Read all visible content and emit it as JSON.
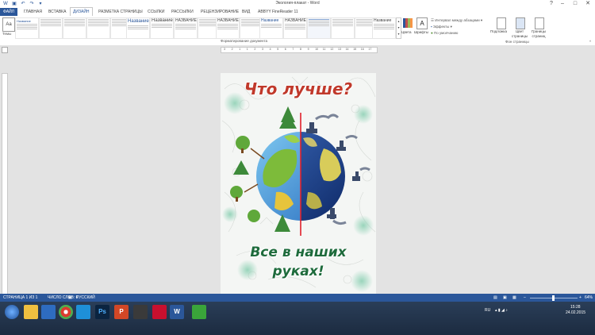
{
  "window": {
    "title": "Экология-плакат - Word"
  },
  "tabs": [
    {
      "label": "ФАЙЛ"
    },
    {
      "label": "ГЛАВНАЯ"
    },
    {
      "label": "ВСТАВКА"
    },
    {
      "label": "ДИЗАЙН"
    },
    {
      "label": "РАЗМЕТКА СТРАНИЦЫ"
    },
    {
      "label": "ССЫЛКИ"
    },
    {
      "label": "РАССЫЛКИ"
    },
    {
      "label": "РЕЦЕНЗИРОВАНИЕ"
    },
    {
      "label": "ВИД"
    },
    {
      "label": "ABBYY FineReader 11"
    }
  ],
  "ribbon": {
    "themes_label": "Темы",
    "doc_format_label": "Форматирование документа",
    "styles": [
      {
        "title": "Название"
      },
      {
        "title": "Название"
      },
      {
        "title": "НАЗВАНИЕ"
      },
      {
        "title": "Название"
      },
      {
        "title": "НАЗВАНИЕ"
      },
      {
        "title": "Название"
      }
    ],
    "colors_label": "Цвета",
    "fonts_label": "Шрифты",
    "spacing_label": "Интервал между абзацами",
    "effects_label": "Эффекты",
    "default_label": "По умолчанию",
    "watermark_label": "Подложка",
    "page_color_label": "Цвет страницы",
    "page_borders_label": "Границы страниц",
    "page_bg_group": "Фон страницы"
  },
  "ruler": {
    "numbers": [
      "3",
      "2",
      "1",
      "1",
      "2",
      "3",
      "4",
      "5",
      "6",
      "7",
      "8",
      "9",
      "10",
      "11",
      "12",
      "13",
      "14",
      "15",
      "16",
      "17"
    ]
  },
  "poster": {
    "title": "Что лучше?",
    "slogan_line1": "Все в наших",
    "slogan_line2": "руках!"
  },
  "status": {
    "page": "СТРАНИЦА 1 ИЗ 1",
    "words": "ЧИСЛО СЛОВ: 6",
    "language": "РУССКИЙ",
    "zoom": "64%"
  },
  "taskbar": {
    "lang": "RU",
    "time": "15:28",
    "date": "24.02.2015"
  },
  "colors": {
    "accent": "#2b579a",
    "poster_title": "#c0392b",
    "poster_slogan": "#1e6b3c"
  }
}
